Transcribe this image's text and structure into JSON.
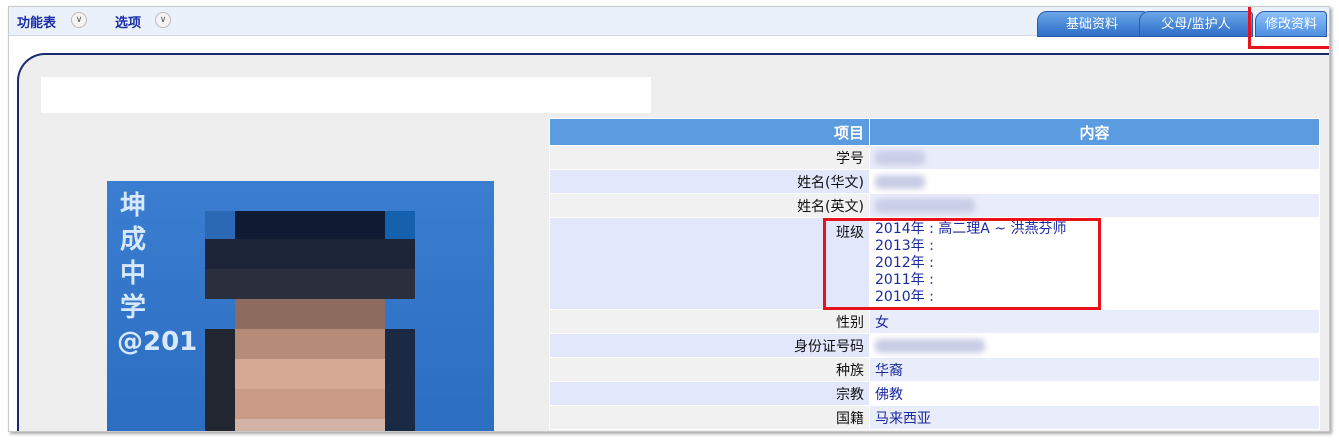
{
  "menu": {
    "function_table": "功能表",
    "options": "选项"
  },
  "tabs": [
    {
      "label": "基础资料"
    },
    {
      "label": "父母/监护人"
    },
    {
      "label": "修改资料"
    }
  ],
  "photo": {
    "caption": "坤成中学@201"
  },
  "table": {
    "header_item": "项目",
    "header_content": "内容",
    "rows": {
      "student_no": {
        "label": "学号"
      },
      "name_cn": {
        "label": "姓名(华文)"
      },
      "name_en": {
        "label": "姓名(英文)"
      },
      "class": {
        "label": "班级",
        "entries": [
          "2014年 : 高二理A ~ 洪燕芬师",
          "2013年 :",
          "2012年 :",
          "2011年 :",
          "2010年 :"
        ]
      },
      "gender": {
        "label": "性别",
        "value": "女"
      },
      "id_no": {
        "label": "身份证号码"
      },
      "race": {
        "label": "种族",
        "value": "华裔"
      },
      "religion": {
        "label": "宗教",
        "value": "佛教"
      },
      "nationality": {
        "label": "国籍",
        "value": "马来西亚"
      }
    }
  },
  "colors": {
    "header_blue": "#5b9be0",
    "link_blue": "#1b2aa0",
    "highlight_red": "#e8131a"
  }
}
